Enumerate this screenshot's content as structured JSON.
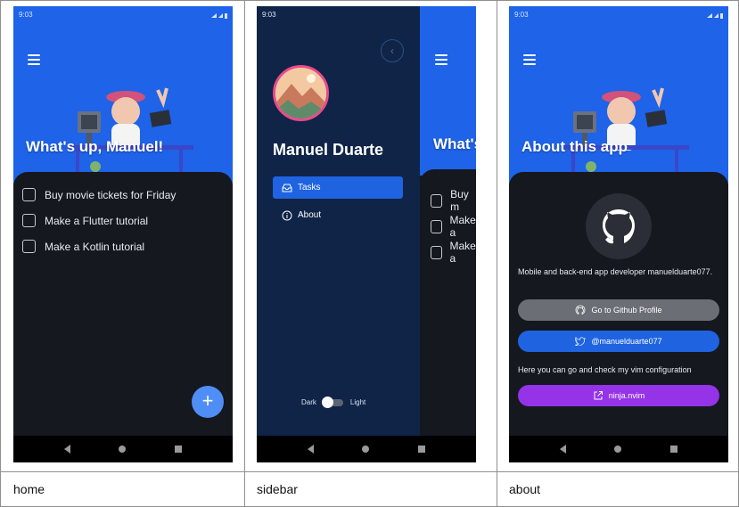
{
  "screens": {
    "home": {
      "status": {
        "time": "9:03"
      },
      "hero_title": "What's up, Manuel!",
      "tasks": [
        "Buy movie tickets for Friday",
        "Make a Flutter tutorial",
        "Make a Kotlin tutorial"
      ],
      "fab_label": "+"
    },
    "sidebar": {
      "status": {
        "time": "9:03"
      },
      "user_name": "Manuel Duarte",
      "menu": [
        {
          "label": "Tasks",
          "icon": "inbox-icon",
          "active": true
        },
        {
          "label": "About",
          "icon": "info-icon",
          "active": false
        }
      ],
      "theme": {
        "dark_label": "Dark",
        "light_label": "Light"
      },
      "peek_title": "What's",
      "peek_tasks": [
        "Buy m",
        "Make a",
        "Make a"
      ]
    },
    "about": {
      "status": {
        "time": "9:03"
      },
      "hero_title": "About this app",
      "bio": "Mobile and back-end app developer manuelduarte077.",
      "buttons": {
        "github": "Go to Github Profile",
        "twitter": "@manuelduarte077",
        "vim": "ninja.nvim"
      },
      "vim_text": "Here you can go and check my vim configuration"
    }
  },
  "captions": {
    "home": "home",
    "sidebar": "sidebar",
    "about": "about"
  },
  "colors": {
    "hero_blue": "#1e63e8",
    "sheet": "#15181f",
    "drawer": "#0f2447",
    "fab": "#4f8ef7",
    "purple": "#9433e8"
  }
}
